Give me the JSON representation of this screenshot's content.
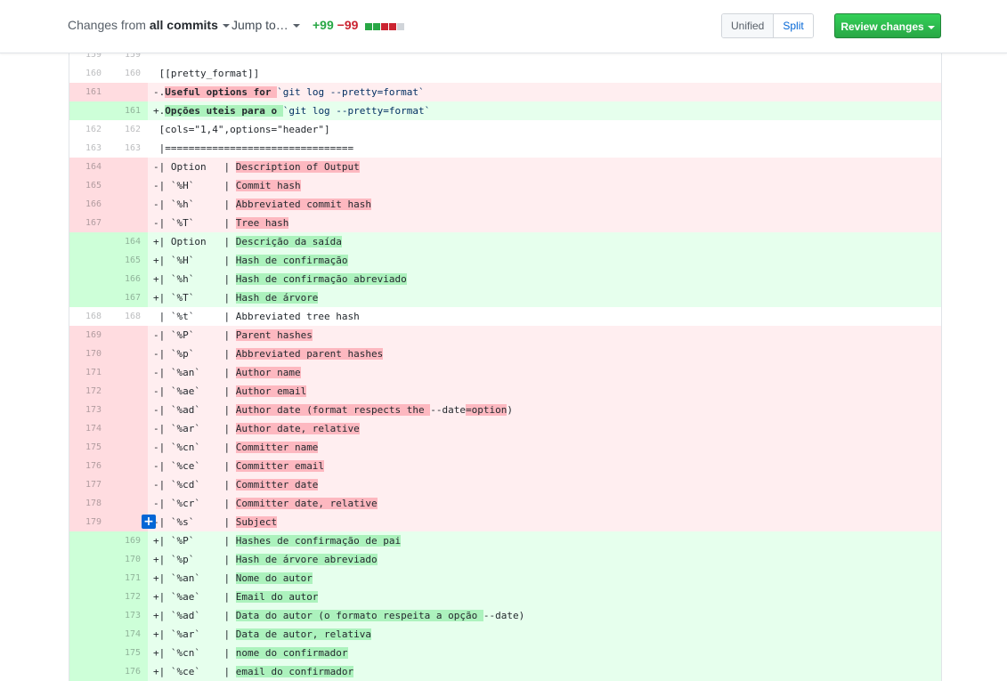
{
  "toolbar": {
    "changes_prefix": "Changes from ",
    "changes_value": "all commits",
    "jump_label": "Jump to…",
    "additions": "+99",
    "deletions": "−99",
    "view_unified": "Unified",
    "view_split": "Split",
    "review_label": "Review changes",
    "colors": {
      "add": "#28a745",
      "del": "#cb2431",
      "neutral": "#d1d5da"
    }
  },
  "diff": {
    "rows": [
      {
        "type": "ctx",
        "o": "159",
        "n": "159",
        "segs": [
          {
            "t": ""
          }
        ]
      },
      {
        "type": "ctx",
        "o": "160",
        "n": "160",
        "segs": [
          {
            "t": " [[pretty_format]]"
          }
        ]
      },
      {
        "type": "del",
        "o": "161",
        "n": "",
        "segs": [
          {
            "t": "-."
          },
          {
            "t": "Useful options for ",
            "c": "hl-del kw"
          },
          {
            "t": "`git log --pretty=format`",
            "c": "blue"
          }
        ]
      },
      {
        "type": "add",
        "o": "",
        "n": "161",
        "segs": [
          {
            "t": "+."
          },
          {
            "t": "Opções uteis para o ",
            "c": "hl-add kw"
          },
          {
            "t": "`git log --pretty=format`",
            "c": "blue"
          }
        ]
      },
      {
        "type": "ctx",
        "o": "162",
        "n": "162",
        "segs": [
          {
            "t": " [cols=\"1,4\",options=\"header\"]"
          }
        ]
      },
      {
        "type": "ctx",
        "o": "163",
        "n": "163",
        "segs": [
          {
            "t": " |================================"
          }
        ]
      },
      {
        "type": "del",
        "o": "164",
        "n": "",
        "segs": [
          {
            "t": "-| Option   | "
          },
          {
            "t": "Description of Output",
            "c": "hl-del"
          }
        ]
      },
      {
        "type": "del",
        "o": "165",
        "n": "",
        "segs": [
          {
            "t": "-| `%H`     | "
          },
          {
            "t": "Commit hash",
            "c": "hl-del"
          }
        ]
      },
      {
        "type": "del",
        "o": "166",
        "n": "",
        "segs": [
          {
            "t": "-| `%h`     | "
          },
          {
            "t": "Abbreviated commit hash",
            "c": "hl-del"
          }
        ]
      },
      {
        "type": "del",
        "o": "167",
        "n": "",
        "segs": [
          {
            "t": "-| `%T`     | "
          },
          {
            "t": "Tree hash",
            "c": "hl-del"
          }
        ]
      },
      {
        "type": "add",
        "o": "",
        "n": "164",
        "segs": [
          {
            "t": "+| Option   | "
          },
          {
            "t": "Descrição da saída",
            "c": "hl-add"
          }
        ]
      },
      {
        "type": "add",
        "o": "",
        "n": "165",
        "segs": [
          {
            "t": "+| `%H`     | "
          },
          {
            "t": "Hash de confirmação",
            "c": "hl-add"
          }
        ]
      },
      {
        "type": "add",
        "o": "",
        "n": "166",
        "segs": [
          {
            "t": "+| `%h`     | "
          },
          {
            "t": "Hash de confirmação abreviado",
            "c": "hl-add"
          }
        ]
      },
      {
        "type": "add",
        "o": "",
        "n": "167",
        "segs": [
          {
            "t": "+| `%T`     | "
          },
          {
            "t": "Hash de árvore",
            "c": "hl-add"
          }
        ]
      },
      {
        "type": "ctx",
        "o": "168",
        "n": "168",
        "segs": [
          {
            "t": " | `%t`     | Abbreviated tree hash"
          }
        ]
      },
      {
        "type": "del",
        "o": "169",
        "n": "",
        "segs": [
          {
            "t": "-| `%P`     | "
          },
          {
            "t": "Parent hashes",
            "c": "hl-del"
          }
        ]
      },
      {
        "type": "del",
        "o": "170",
        "n": "",
        "segs": [
          {
            "t": "-| `%p`     | "
          },
          {
            "t": "Abbreviated parent hashes",
            "c": "hl-del"
          }
        ]
      },
      {
        "type": "del",
        "o": "171",
        "n": "",
        "segs": [
          {
            "t": "-| `%an`    | "
          },
          {
            "t": "Author name",
            "c": "hl-del"
          }
        ]
      },
      {
        "type": "del",
        "o": "172",
        "n": "",
        "segs": [
          {
            "t": "-| `%ae`    | "
          },
          {
            "t": "Author email",
            "c": "hl-del"
          }
        ]
      },
      {
        "type": "del",
        "o": "173",
        "n": "",
        "segs": [
          {
            "t": "-| `%ad`    | "
          },
          {
            "t": "Author date (format respects the ",
            "c": "hl-del"
          },
          {
            "t": "--date"
          },
          {
            "t": "=option",
            "c": "hl-del"
          },
          {
            "t": ")"
          }
        ]
      },
      {
        "type": "del",
        "o": "174",
        "n": "",
        "segs": [
          {
            "t": "-| `%ar`    | "
          },
          {
            "t": "Author date, relative",
            "c": "hl-del"
          }
        ]
      },
      {
        "type": "del",
        "o": "175",
        "n": "",
        "segs": [
          {
            "t": "-| `%cn`    | "
          },
          {
            "t": "Committer name",
            "c": "hl-del"
          }
        ]
      },
      {
        "type": "del",
        "o": "176",
        "n": "",
        "segs": [
          {
            "t": "-| `%ce`    | "
          },
          {
            "t": "Committer email",
            "c": "hl-del"
          }
        ]
      },
      {
        "type": "del",
        "o": "177",
        "n": "",
        "segs": [
          {
            "t": "-| `%cd`    | "
          },
          {
            "t": "Committer date",
            "c": "hl-del"
          }
        ]
      },
      {
        "type": "del",
        "o": "178",
        "n": "",
        "segs": [
          {
            "t": "-| `%cr`    | "
          },
          {
            "t": "Committer date, relative",
            "c": "hl-del"
          }
        ]
      },
      {
        "type": "del",
        "o": "179",
        "n": "",
        "plus": true,
        "segs": [
          {
            "t": "-| `%s`     | "
          },
          {
            "t": "Subject",
            "c": "hl-del"
          }
        ]
      },
      {
        "type": "add",
        "o": "",
        "n": "169",
        "segs": [
          {
            "t": "+| `%P`     | "
          },
          {
            "t": "Hashes de confirmação de pai",
            "c": "hl-add"
          }
        ]
      },
      {
        "type": "add",
        "o": "",
        "n": "170",
        "segs": [
          {
            "t": "+| `%p`     | "
          },
          {
            "t": "Hash de árvore abreviado",
            "c": "hl-add"
          }
        ]
      },
      {
        "type": "add",
        "o": "",
        "n": "171",
        "segs": [
          {
            "t": "+| `%an`    | "
          },
          {
            "t": "Nome do autor",
            "c": "hl-add"
          }
        ]
      },
      {
        "type": "add",
        "o": "",
        "n": "172",
        "segs": [
          {
            "t": "+| `%ae`    | "
          },
          {
            "t": "Email do autor",
            "c": "hl-add"
          }
        ]
      },
      {
        "type": "add",
        "o": "",
        "n": "173",
        "segs": [
          {
            "t": "+| `%ad`    | "
          },
          {
            "t": "Data do autor (o formato respeita a opção ",
            "c": "hl-add"
          },
          {
            "t": "--date)"
          }
        ]
      },
      {
        "type": "add",
        "o": "",
        "n": "174",
        "segs": [
          {
            "t": "+| `%ar`    | "
          },
          {
            "t": "Data de autor, relativa",
            "c": "hl-add"
          }
        ]
      },
      {
        "type": "add",
        "o": "",
        "n": "175",
        "segs": [
          {
            "t": "+| `%cn`    | "
          },
          {
            "t": "nome do confirmador",
            "c": "hl-add"
          }
        ]
      },
      {
        "type": "add",
        "o": "",
        "n": "176",
        "segs": [
          {
            "t": "+| `%ce`    | "
          },
          {
            "t": "email do confirmador",
            "c": "hl-add"
          }
        ]
      }
    ]
  }
}
